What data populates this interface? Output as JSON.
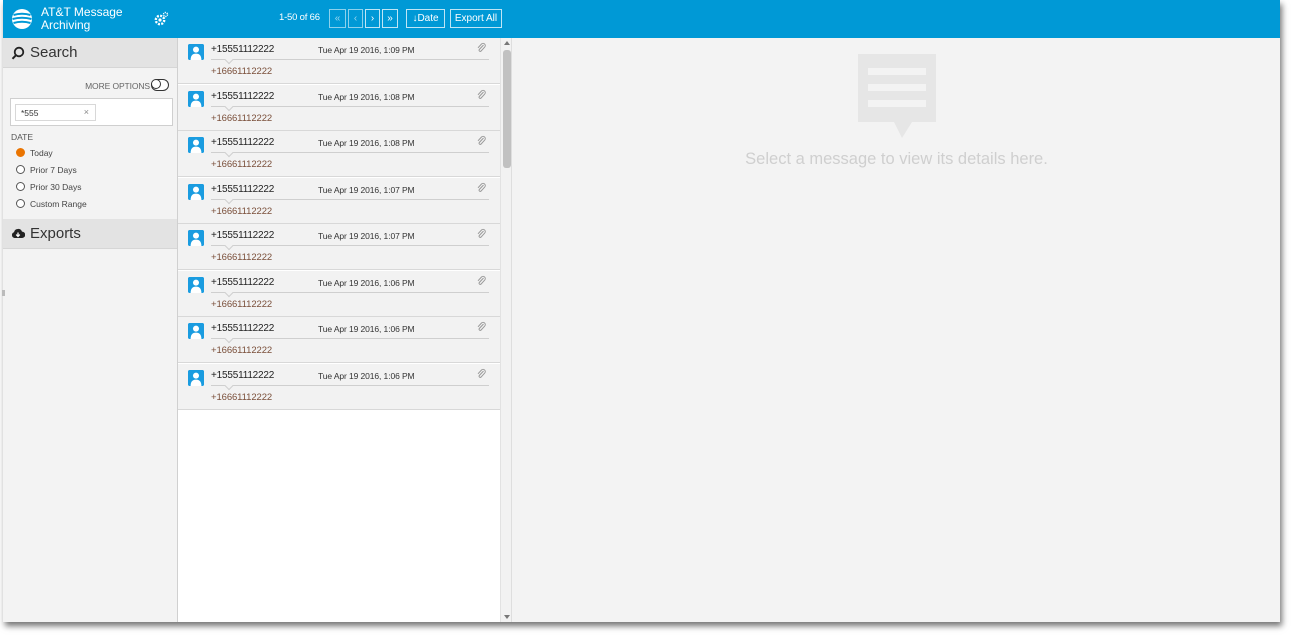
{
  "app": {
    "title": "AT&T Message Archiving",
    "brand_color": "#0099d6"
  },
  "pager": {
    "count_text": "1-50 of 66",
    "first": "«",
    "prev": "‹",
    "next": "›",
    "last": "»",
    "sort_label": "Date",
    "sort_icon": "↓",
    "export_all": "Export All"
  },
  "sidebar": {
    "search_title": "Search",
    "more_options": "MORE OPTIONS",
    "search_chip": "*555",
    "chip_remove": "×",
    "date_label": "DATE",
    "date_options": [
      {
        "label": "Today",
        "selected": true
      },
      {
        "label": "Prior 7 Days",
        "selected": false
      },
      {
        "label": "Prior 30 Days",
        "selected": false
      },
      {
        "label": "Custom Range",
        "selected": false
      }
    ],
    "exports_title": "Exports",
    "accent_color": "#ea7400"
  },
  "messages": [
    {
      "from": "+15551112222",
      "time": "Tue Apr 19 2016, 1:09 PM",
      "to": "+16661112222"
    },
    {
      "from": "+15551112222",
      "time": "Tue Apr 19 2016, 1:08 PM",
      "to": "+16661112222"
    },
    {
      "from": "+15551112222",
      "time": "Tue Apr 19 2016, 1:08 PM",
      "to": "+16661112222"
    },
    {
      "from": "+15551112222",
      "time": "Tue Apr 19 2016, 1:07 PM",
      "to": "+16661112222"
    },
    {
      "from": "+15551112222",
      "time": "Tue Apr 19 2016, 1:07 PM",
      "to": "+16661112222"
    },
    {
      "from": "+15551112222",
      "time": "Tue Apr 19 2016, 1:06 PM",
      "to": "+16661112222"
    },
    {
      "from": "+15551112222",
      "time": "Tue Apr 19 2016, 1:06 PM",
      "to": "+16661112222"
    },
    {
      "from": "+15551112222",
      "time": "Tue Apr 19 2016, 1:06 PM",
      "to": "+16661112222"
    }
  ],
  "detail": {
    "empty_text": "Select a message to view its details here."
  }
}
